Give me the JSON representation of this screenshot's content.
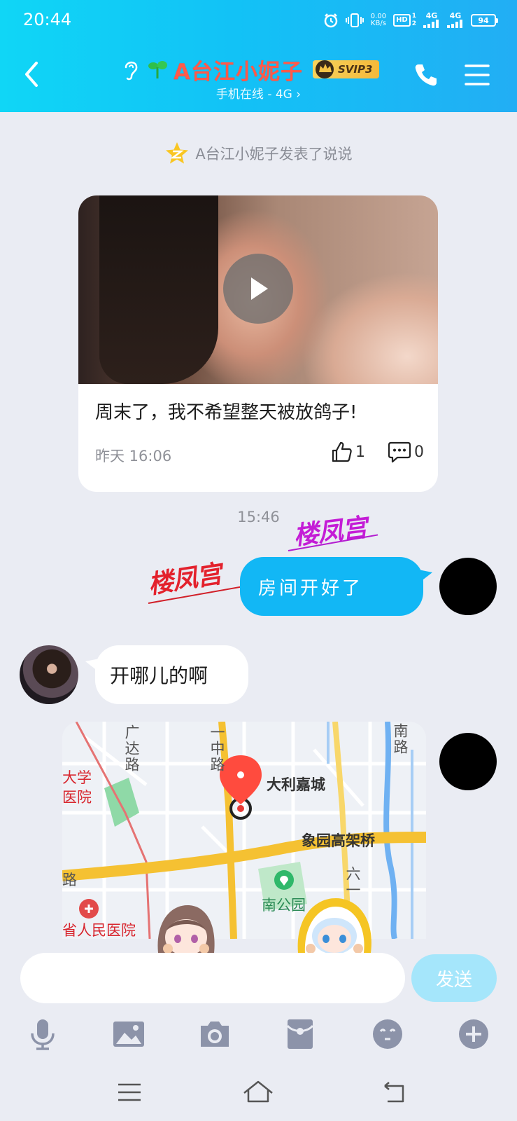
{
  "status_bar": {
    "time": "20:44",
    "net_speed": "0.00",
    "net_speed_unit": "KB/s",
    "hd_label": "HD",
    "sim_index_top": "1",
    "sim_index_bottom": "2",
    "signal_1": "4G",
    "signal_2": "4G",
    "battery": "94"
  },
  "header": {
    "contact_name": "A台江小妮子",
    "vip_badge": "SVIP3",
    "online_status": "手机在线 - 4G ›"
  },
  "chat": {
    "system_notice": "A台江小妮子发表了说说",
    "post": {
      "text": "周末了，我不希望整天被放鸽子!",
      "time": "昨天 16:06",
      "likes": "1",
      "comments": "0"
    },
    "timestamp": "15:46",
    "stickers": [
      "楼凤宫",
      "楼凤宫"
    ],
    "messages": [
      {
        "from": "self",
        "text": "房间开好了"
      },
      {
        "from": "contact",
        "text": "开哪儿的啊"
      }
    ],
    "location_map": {
      "poi": "大利嘉城",
      "labels": {
        "guangda_road": "广达路",
        "yizhong_road": "一中路",
        "south_road": "南路",
        "university_hospital_1": "大学",
        "university_hospital_2": "医院",
        "elevated_bridge": "象园高架桥",
        "road_fragment": "路",
        "south_park": "南公园",
        "liuyi_road": "六一",
        "provincial_hospital": "省人民医院"
      }
    }
  },
  "input": {
    "placeholder": "",
    "value": "",
    "send_label": "发送"
  },
  "colors": {
    "header_gradient_start": "#10d6f6",
    "header_gradient_end": "#22aef4",
    "outgoing_bubble": "#12b7f5",
    "contact_name": "#ff5a4a",
    "send_button": "#a5e6fb",
    "background": "#eaecf3"
  },
  "toolbar_icons": [
    "microphone-icon",
    "image-icon",
    "camera-icon",
    "red-packet-icon",
    "emoji-icon",
    "plus-icon"
  ],
  "nav_icons": [
    "recent-apps-icon",
    "home-icon",
    "back-nav-icon"
  ]
}
